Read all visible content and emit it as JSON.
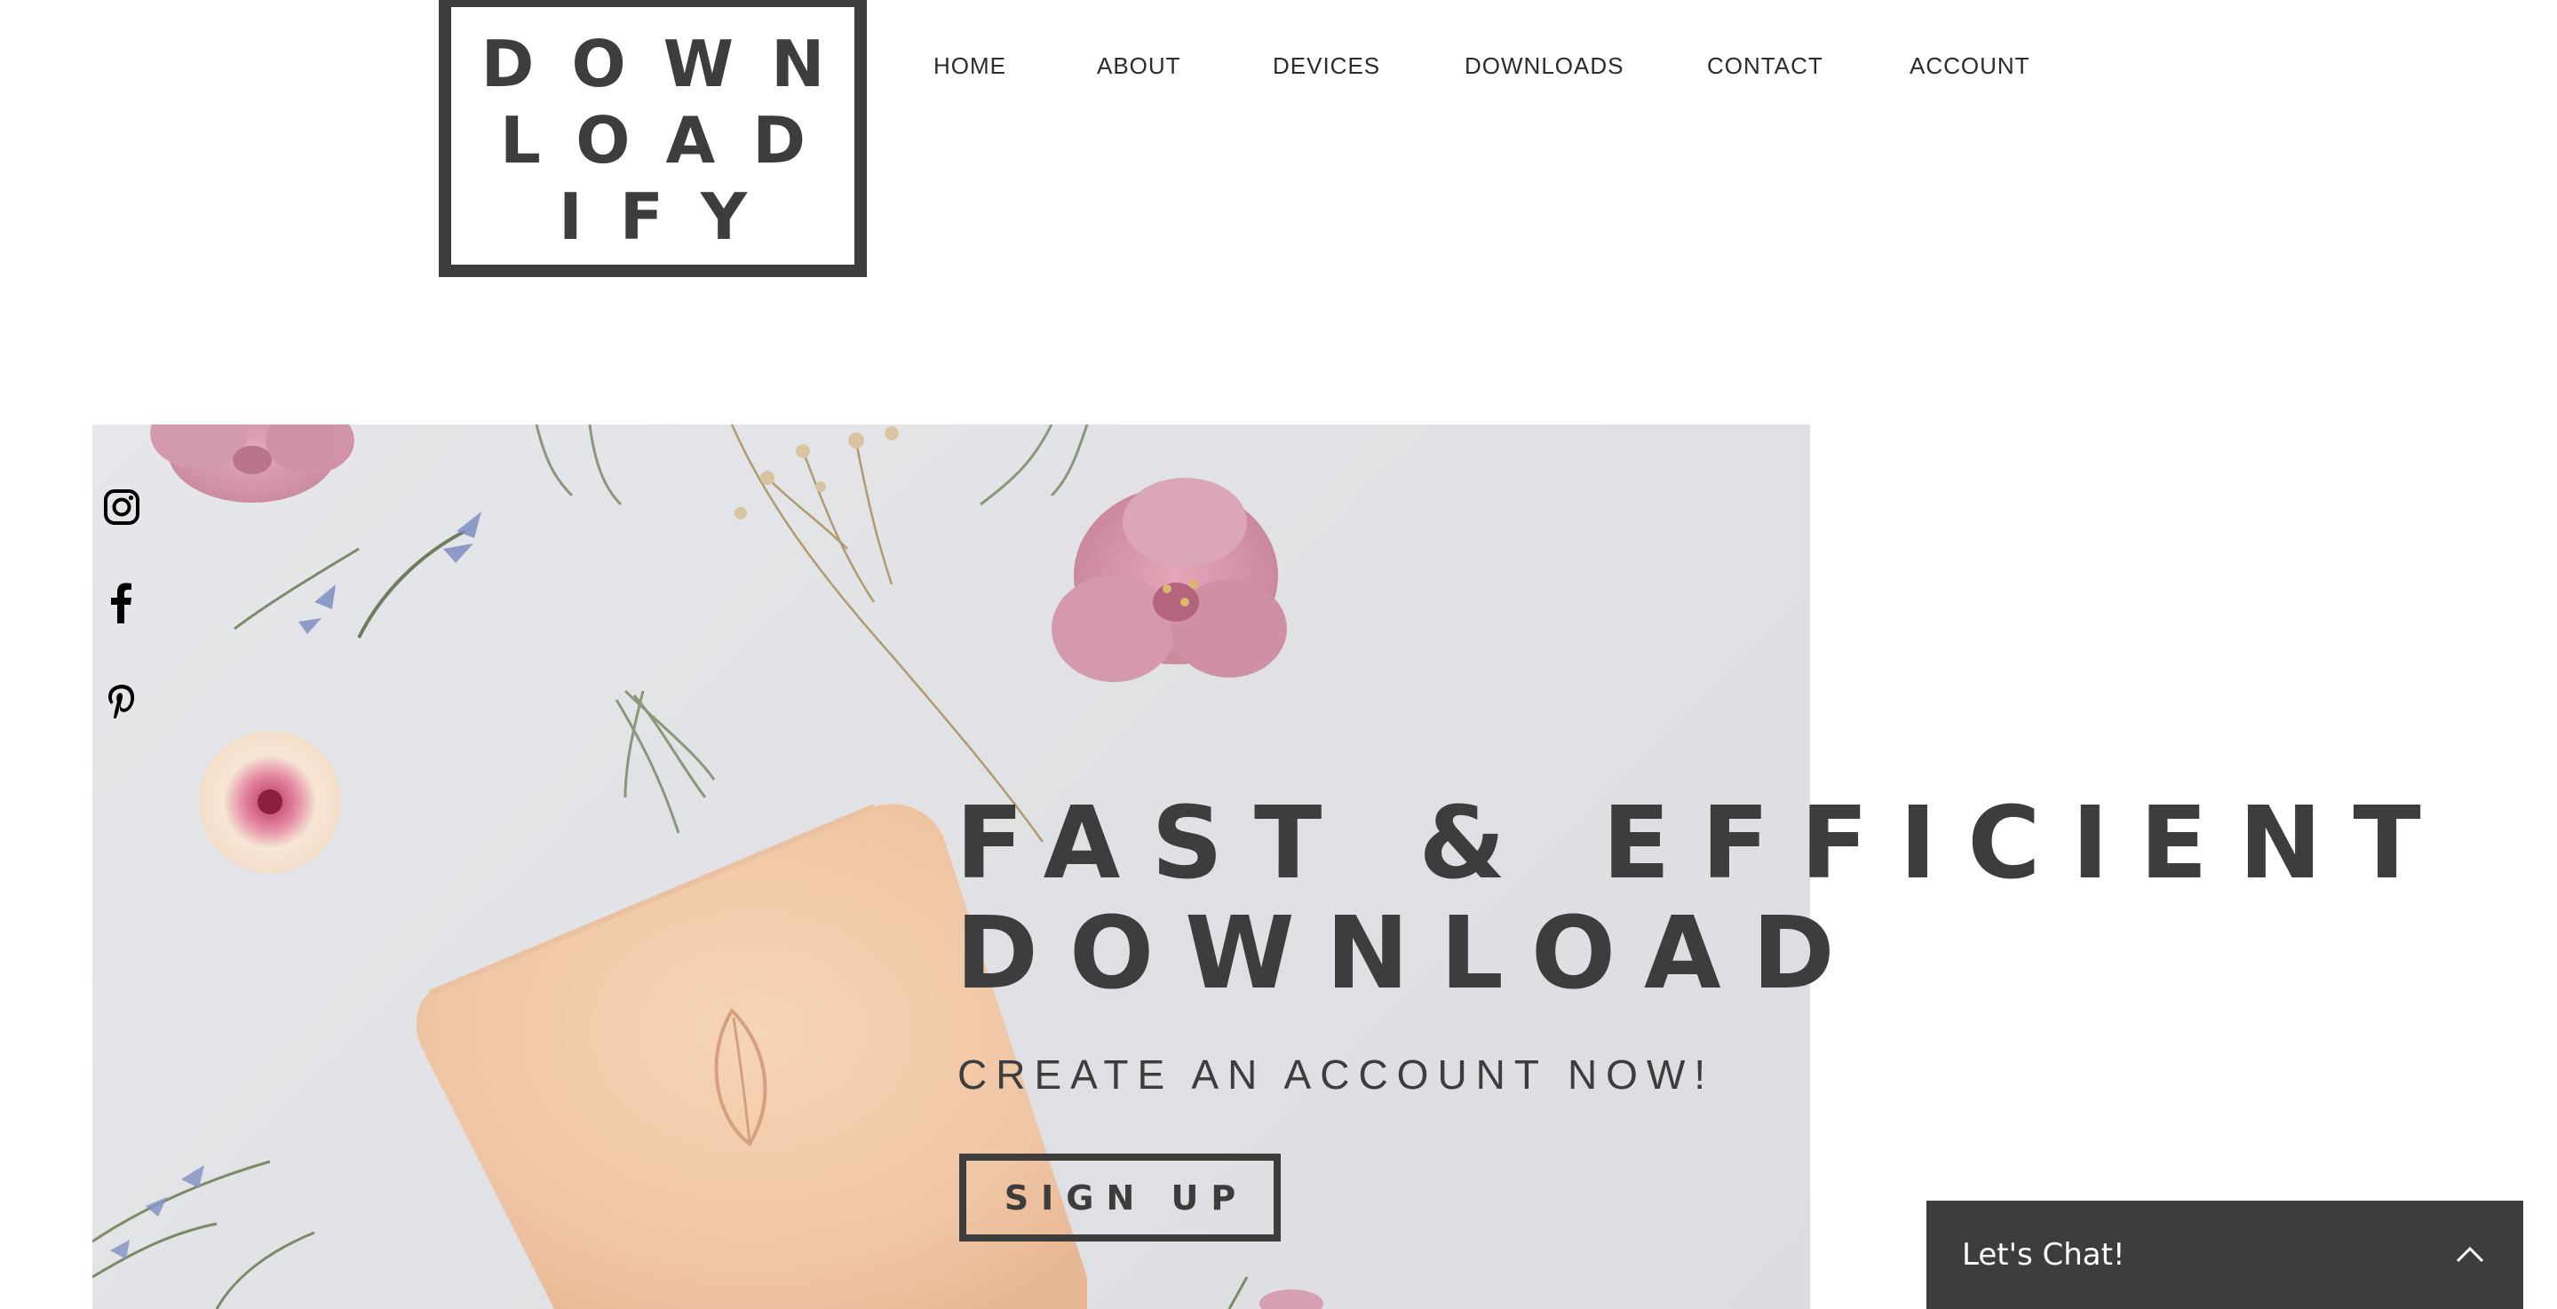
{
  "brand": {
    "logo_lines": [
      "DOWN",
      "LOAD",
      "IFY"
    ]
  },
  "nav": {
    "items": [
      {
        "label": "HOME"
      },
      {
        "label": "ABOUT"
      },
      {
        "label": "DEVICES"
      },
      {
        "label": "DOWNLOADS"
      },
      {
        "label": "CONTACT"
      },
      {
        "label": "ACCOUNT"
      }
    ]
  },
  "social": {
    "icons": [
      "instagram-icon",
      "facebook-icon",
      "pinterest-icon"
    ]
  },
  "hero": {
    "headline": "FAST & EFFICIENT\nDOWNLOAD",
    "subheadline": "CREATE AN ACCOUNT NOW!",
    "cta_label": "SIGN UP"
  },
  "chat": {
    "label": "Let's Chat!",
    "toggle_icon": "chevron-up-icon"
  },
  "colors": {
    "text_dark": "#3d3d3d",
    "background": "#ffffff",
    "hero_background": "#e3e4e7",
    "chat_background": "#3d3d3d",
    "chat_text": "#ffffff"
  }
}
